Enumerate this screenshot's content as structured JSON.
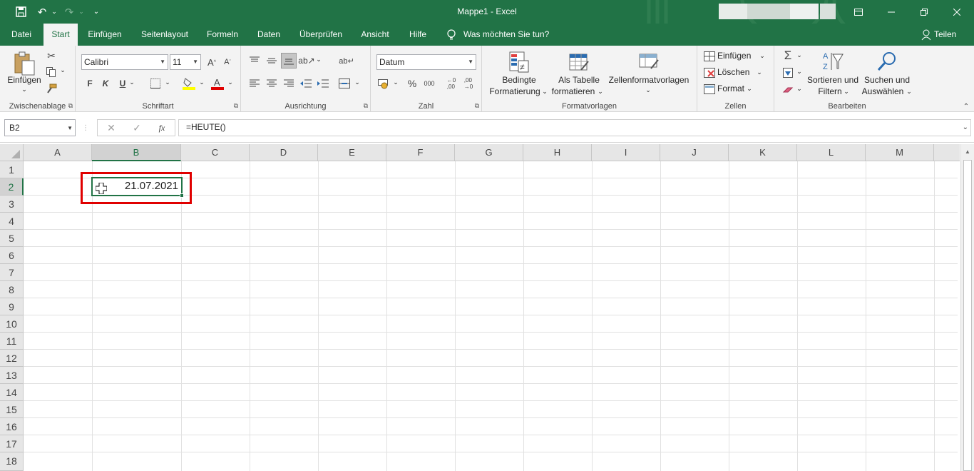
{
  "title": {
    "text": "Mappe1  -  Excel"
  },
  "qat": {
    "save_icon": "save-icon",
    "undo_icon": "undo-icon",
    "redo_icon": "redo-icon",
    "customize_icon": "customize-qat-icon"
  },
  "window": {
    "ribbon_display_icon": "ribbon-display-options-icon"
  },
  "tabs": [
    "Datei",
    "Start",
    "Einfügen",
    "Seitenlayout",
    "Formeln",
    "Daten",
    "Überprüfen",
    "Ansicht",
    "Hilfe"
  ],
  "tell_me": "Was möchten Sie tun?",
  "share": "Teilen",
  "ribbon": {
    "clipboard": {
      "paste": "Einfügen",
      "label": "Zwischenablage"
    },
    "font": {
      "name": "Calibri",
      "size": "11",
      "bold": "F",
      "italic": "K",
      "underline": "U",
      "label": "Schriftart"
    },
    "alignment": {
      "label": "Ausrichtung"
    },
    "number": {
      "format": "Datum",
      "percent": "%",
      "thousands": "000",
      "label": "Zahl"
    },
    "styles": {
      "conditional_1": "Bedingte",
      "conditional_2": "Formatierung",
      "table_1": "Als Tabelle",
      "table_2": "formatieren",
      "cell_styles": "Zellenformatvorlagen",
      "label": "Formatvorlagen"
    },
    "cells": {
      "insert": "Einfügen",
      "delete": "Löschen",
      "format": "Format",
      "label": "Zellen"
    },
    "editing": {
      "sort_1": "Sortieren und",
      "sort_2": "Filtern",
      "find_1": "Suchen und",
      "find_2": "Auswählen",
      "label": "Bearbeiten"
    }
  },
  "formula_bar": {
    "name_box": "B2",
    "formula": "=HEUTE()",
    "fx": "fx"
  },
  "sheet": {
    "columns": [
      "A",
      "B",
      "C",
      "D",
      "E",
      "F",
      "G",
      "H",
      "I",
      "J",
      "K",
      "L",
      "M"
    ],
    "rows": [
      "1",
      "2",
      "3",
      "4",
      "5",
      "6",
      "7",
      "8",
      "9",
      "10",
      "11",
      "12",
      "13",
      "14",
      "15",
      "16",
      "17",
      "18"
    ],
    "selected_cell": "B2",
    "cell_B2": "21.07.2021"
  },
  "colors": {
    "excel_green": "#217346",
    "highlight_red": "#e00000"
  }
}
